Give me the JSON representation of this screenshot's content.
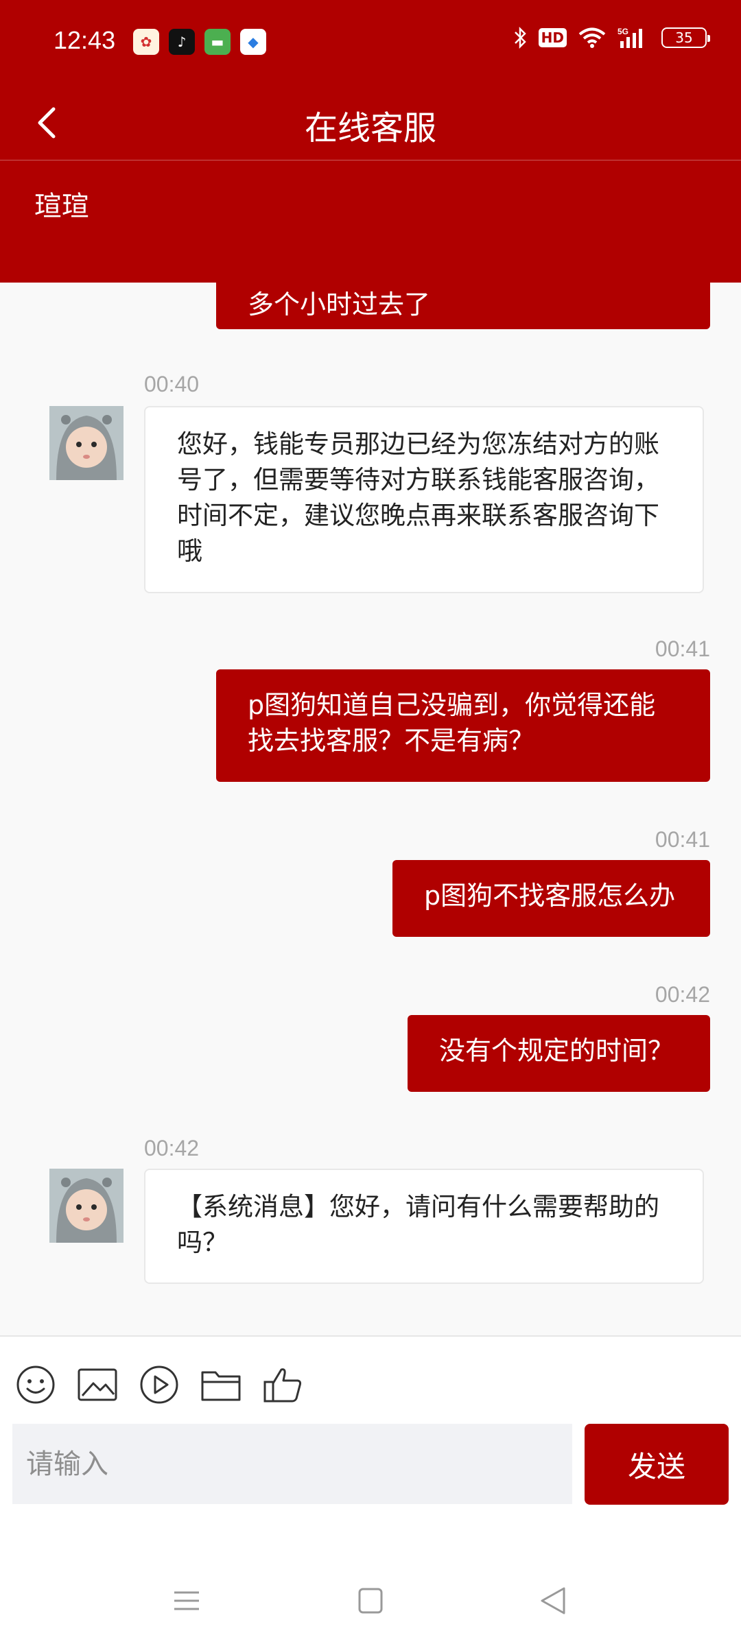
{
  "status_bar": {
    "time": "12:43",
    "battery": "35",
    "network": "5G"
  },
  "header": {
    "title": "在线客服",
    "agent_name": "瑄瑄"
  },
  "messages": [
    {
      "side": "out",
      "time": "",
      "text": "多个小时过去了"
    },
    {
      "side": "in",
      "time": "00:40",
      "text": "您好，钱能专员那边已经为您冻结对方的账号了，但需要等待对方联系钱能客服咨询，时间不定，建议您晚点再来联系客服咨询下哦"
    },
    {
      "side": "out",
      "time": "00:41",
      "text": "p图狗知道自己没骗到，你觉得还能找去找客服？不是有病？"
    },
    {
      "side": "out",
      "time": "00:41",
      "text": "p图狗不找客服怎么办"
    },
    {
      "side": "out",
      "time": "00:42",
      "text": "没有个规定的时间？"
    },
    {
      "side": "in",
      "time": "00:42",
      "text": "【系统消息】您好，请问有什么需要帮助的吗？"
    }
  ],
  "composer": {
    "placeholder": "请输入",
    "send_label": "发送"
  },
  "colors": {
    "brand_red": "#b00000",
    "background": "#f9f9f9"
  },
  "icons": [
    "emoji-icon",
    "image-icon",
    "video-icon",
    "folder-icon",
    "thumbs-up-icon"
  ]
}
